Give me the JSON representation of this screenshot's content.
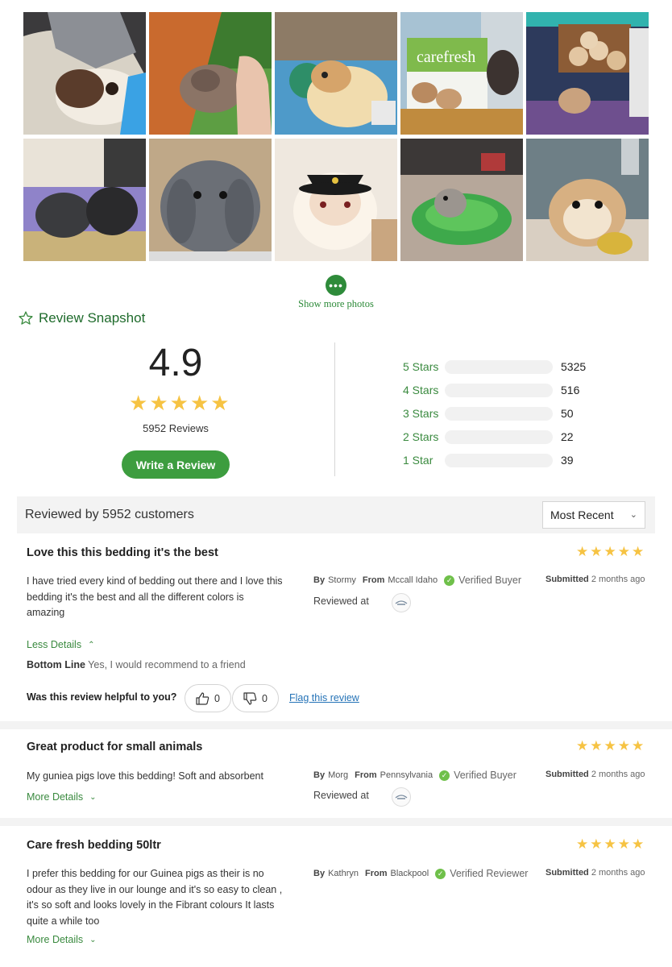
{
  "photos": {
    "items": [
      {
        "alt": "guinea pig on blanket"
      },
      {
        "alt": "rat in hand"
      },
      {
        "alt": "guinea pig on blue bedding"
      },
      {
        "alt": "carefresh bag with rabbits",
        "label": "carefresh"
      },
      {
        "alt": "hamster house with wood logs"
      },
      {
        "alt": "two guinea pigs on hay"
      },
      {
        "alt": "grey lop rabbit"
      },
      {
        "alt": "hamster with tiny hat"
      },
      {
        "alt": "hamster in green bowl"
      },
      {
        "alt": "hamster close-up"
      }
    ],
    "show_more_label": "Show more photos"
  },
  "snapshot": {
    "title": "Review Snapshot",
    "average": "4.9",
    "stars": 5,
    "review_count_label": "5952 Reviews",
    "write_review_label": "Write a Review",
    "distribution": [
      {
        "label": "5 Stars",
        "count": "5325",
        "value": 5325
      },
      {
        "label": "4 Stars",
        "count": "516",
        "value": 516
      },
      {
        "label": "3 Stars",
        "count": "50",
        "value": 50
      },
      {
        "label": "2 Stars",
        "count": "22",
        "value": 22
      },
      {
        "label": "1 Star",
        "count": "39",
        "value": 39
      }
    ]
  },
  "filter": {
    "title": "Reviewed by 5952 customers",
    "sort_value": "Most Recent"
  },
  "labels": {
    "by": "By",
    "from": "From",
    "submitted": "Submitted",
    "reviewed_at": "Reviewed at",
    "less_details": "Less Details",
    "more_details": "More Details",
    "bottom_line": "Bottom Line",
    "helpful_question": "Was this review helpful to you?",
    "flag": "Flag this review"
  },
  "reviews": [
    {
      "title": "Love this this bedding it's the best",
      "rating": 5,
      "body": "I have tried every kind of bedding out there and I love this bedding it's the best and all the different colors is amazing",
      "author": "Stormy",
      "location": "Mccall Idaho",
      "badge": "Verified Buyer",
      "submitted": "2 months ago",
      "bottom_line": "Yes, I would recommend to a friend",
      "helpful_yes": "0",
      "helpful_no": "0"
    },
    {
      "title": "Great product for small animals",
      "rating": 5,
      "body": "My guniea pigs love this bedding! Soft and absorbent",
      "author": "Morg",
      "location": "Pennsylvania",
      "badge": "Verified Buyer",
      "submitted": "2 months ago"
    },
    {
      "title": "Care fresh bedding 50ltr",
      "rating": 5,
      "body": "I prefer this bedding for our Guinea pigs as their is no odour as they live in our lounge and it's so easy to clean , it's so soft and looks lovely in the Fibrant colours It lasts quite a while too",
      "author": "Kathryn",
      "location": "Blackpool",
      "badge": "Verified Reviewer",
      "submitted": "2 months ago"
    }
  ],
  "colors": {
    "accent_green": "#3d9d3f",
    "star_gold": "#f6c343",
    "bar_yellow": "#f5de14",
    "link_blue": "#2573b7"
  }
}
